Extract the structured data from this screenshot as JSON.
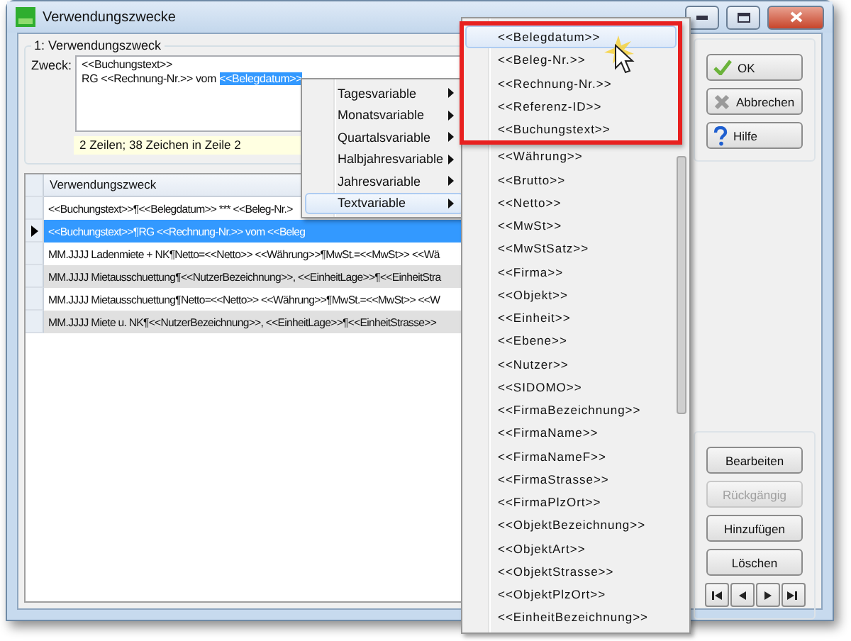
{
  "window": {
    "title": "Verwendungszwecke"
  },
  "purpose_group": {
    "title": "1: Verwendungszweck",
    "label": "Zweck:",
    "lines": [
      {
        "text": "<<Buchungstext>>"
      },
      {
        "text": "RG <<Rechnung-Nr.>> vom ",
        "selected_text": "<<Belegdatum>>"
      }
    ],
    "status": "2 Zeilen; 38 Zeichen in Zeile 2"
  },
  "table": {
    "columns": [
      "Verwendungszweck"
    ],
    "rows": [
      {
        "text": "<<Buchungstext>>¶<<Belegdatum>> *** <<Beleg-Nr.>",
        "selected": false,
        "shaded": false
      },
      {
        "text": "<<Buchungstext>>¶RG <<Rechnung-Nr.>> vom <<Beleg",
        "selected": true,
        "shaded": false
      },
      {
        "text": "MM.JJJJ Ladenmiete + NK¶Netto=<<Netto>> <<Währung>>¶MwSt.=<<MwSt>> <<Wä",
        "selected": false,
        "shaded": false
      },
      {
        "text": "MM.JJJJ Mietausschuettung¶<<NutzerBezeichnung>>, <<EinheitLage>>¶<<EinheitStra",
        "selected": false,
        "shaded": true
      },
      {
        "text": "MM.JJJJ Mietausschuettung¶Netto=<<Netto>> <<Währung>>¶MwSt.=<<MwSt>> <<W",
        "selected": false,
        "shaded": false
      },
      {
        "text": "MM.JJJJ Miete u. NK¶<<NutzerBezeichnung>>, <<EinheitLage>>¶<<EinheitStrasse>>",
        "selected": false,
        "shaded": true
      }
    ]
  },
  "dialog_buttons": [
    {
      "label": "OK",
      "kind": "ok"
    },
    {
      "label": "Abbrechen",
      "kind": "cancel"
    },
    {
      "label": "Hilfe",
      "kind": "help"
    }
  ],
  "actions": [
    {
      "label": "Bearbeiten",
      "disabled": false
    },
    {
      "label": "Rückgängig",
      "disabled": true
    },
    {
      "label": "Hinzufügen",
      "disabled": false
    },
    {
      "label": "Löschen",
      "disabled": false
    }
  ],
  "navigation": [
    {
      "kind": "first"
    },
    {
      "kind": "prev"
    },
    {
      "kind": "next"
    },
    {
      "kind": "last"
    }
  ],
  "context_menu": {
    "items": [
      {
        "label": "Tagesvariable",
        "selected": false
      },
      {
        "label": "Monatsvariable",
        "selected": false
      },
      {
        "label": "Quartalsvariable",
        "selected": false
      },
      {
        "label": "Halbjahresvariable",
        "selected": false
      },
      {
        "label": "Jahresvariable",
        "selected": false
      },
      {
        "label": "Textvariable",
        "selected": true
      }
    ]
  },
  "submenu": {
    "items": [
      {
        "label": "<<Belegdatum>>",
        "selected": true,
        "highlighted": true
      },
      {
        "label": "<<Beleg-Nr.>>",
        "selected": false,
        "highlighted": true
      },
      {
        "label": "<<Rechnung-Nr.>>",
        "selected": false,
        "highlighted": true
      },
      {
        "label": "<<Referenz-ID>>",
        "selected": false,
        "highlighted": true
      },
      {
        "label": "<<Buchungstext>>",
        "selected": false,
        "highlighted": true
      },
      {
        "label": "<<Währung>>",
        "selected": false,
        "highlighted": false
      },
      {
        "label": "<<Brutto>>",
        "selected": false,
        "highlighted": false
      },
      {
        "label": "<<Netto>>",
        "selected": false,
        "highlighted": false
      },
      {
        "label": "<<MwSt>>",
        "selected": false,
        "highlighted": false
      },
      {
        "label": "<<MwStSatz>>",
        "selected": false,
        "highlighted": false
      },
      {
        "label": "<<Firma>>",
        "selected": false,
        "highlighted": false
      },
      {
        "label": "<<Objekt>>",
        "selected": false,
        "highlighted": false
      },
      {
        "label": "<<Einheit>>",
        "selected": false,
        "highlighted": false
      },
      {
        "label": "<<Ebene>>",
        "selected": false,
        "highlighted": false
      },
      {
        "label": "<<Nutzer>>",
        "selected": false,
        "highlighted": false
      },
      {
        "label": "<<SIDOMO>>",
        "selected": false,
        "highlighted": false
      },
      {
        "label": "<<FirmaBezeichnung>>",
        "selected": false,
        "highlighted": false
      },
      {
        "label": "<<FirmaName>>",
        "selected": false,
        "highlighted": false
      },
      {
        "label": "<<FirmaNameF>>",
        "selected": false,
        "highlighted": false
      },
      {
        "label": "<<FirmaStrasse>>",
        "selected": false,
        "highlighted": false
      },
      {
        "label": "<<FirmaPlzOrt>>",
        "selected": false,
        "highlighted": false
      },
      {
        "label": "<<ObjektBezeichnung>>",
        "selected": false,
        "highlighted": false
      },
      {
        "label": "<<ObjektArt>>",
        "selected": false,
        "highlighted": false
      },
      {
        "label": "<<ObjektStrasse>>",
        "selected": false,
        "highlighted": false
      },
      {
        "label": "<<ObjektPlzOrt>>",
        "selected": false,
        "highlighted": false
      },
      {
        "label": "<<EinheitBezeichnung>>",
        "selected": false,
        "highlighted": false
      }
    ]
  }
}
